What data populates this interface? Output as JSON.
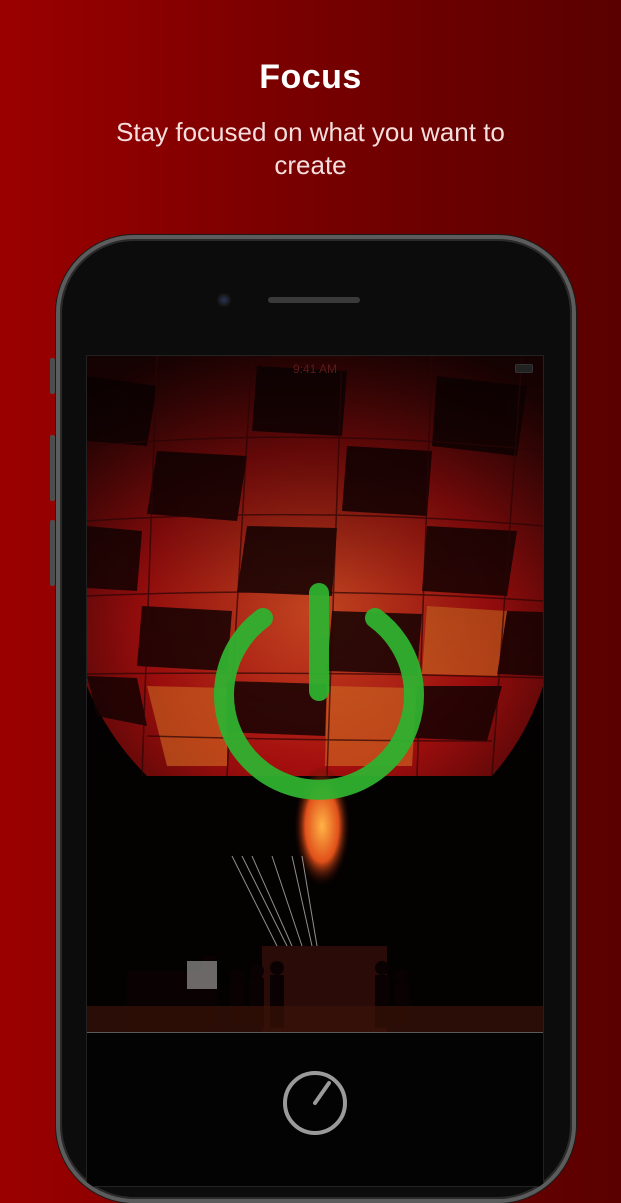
{
  "header": {
    "title": "Focus",
    "subtitle": "Stay focused on what you want to create"
  },
  "phone": {
    "status_time": "9:41 AM",
    "power_icon": "power-icon",
    "timer_icon": "timer-icon",
    "power_color": "#2fb12f",
    "background_image": "hot-air-balloon-at-night"
  }
}
